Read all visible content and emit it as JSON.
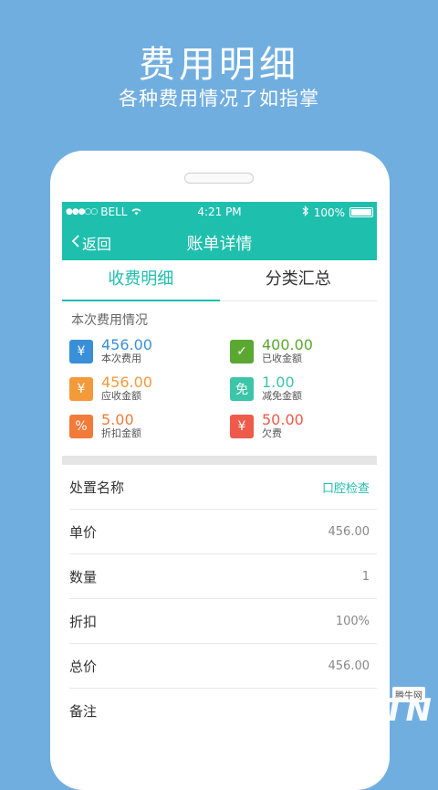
{
  "promo": {
    "title": "费用明细",
    "subtitle": "各种费用情况了如指掌"
  },
  "statusbar": {
    "carrier": "BELL",
    "time": "4:21 PM",
    "battery": "100%"
  },
  "navbar": {
    "back_label": "返回",
    "title": "账单详情"
  },
  "tabs": [
    {
      "label": "收费明细",
      "active": true
    },
    {
      "label": "分类汇总",
      "active": false
    }
  ],
  "summary": {
    "title": "本次费用情况",
    "items": [
      {
        "value": "456.00",
        "label": "本次费用",
        "icon": "money-bag-icon",
        "color": "#3a8fd9",
        "glyph": "¥"
      },
      {
        "value": "400.00",
        "label": "已收金额",
        "icon": "received-icon",
        "color": "#5aa832",
        "glyph": "✓"
      },
      {
        "value": "456.00",
        "label": "应收金额",
        "icon": "house-yen-icon",
        "color": "#f39a3b",
        "glyph": "¥"
      },
      {
        "value": "1.00",
        "label": "减免金额",
        "icon": "waive-icon",
        "color": "#3cc5a8",
        "glyph": "免"
      },
      {
        "value": "5.00",
        "label": "折扣金额",
        "icon": "discount-tag-icon",
        "color": "#f27a3a",
        "glyph": "%"
      },
      {
        "value": "50.00",
        "label": "欠费",
        "icon": "owe-icon",
        "color": "#ef5a4a",
        "glyph": "¥"
      }
    ]
  },
  "details": [
    {
      "key": "处置名称",
      "value": "口腔检查",
      "link": true
    },
    {
      "key": "单价",
      "value": "456.00",
      "link": false
    },
    {
      "key": "数量",
      "value": "1",
      "link": false
    },
    {
      "key": "折扣",
      "value": "100%",
      "link": false
    },
    {
      "key": "总价",
      "value": "456.00",
      "link": false
    },
    {
      "key": "备注",
      "value": "",
      "link": false
    }
  ],
  "watermark": {
    "badge": "腾牛网",
    "logo": "QQTN"
  }
}
